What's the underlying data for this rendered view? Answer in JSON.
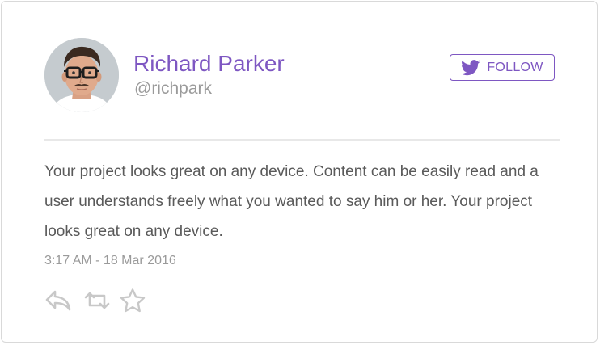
{
  "profile": {
    "name": "Richard Parker",
    "handle": "@richpark"
  },
  "follow_button": {
    "label": "FOLLOW",
    "icon": "twitter-bird-icon"
  },
  "tweet": {
    "text": "Your project looks great on any device. Content can be easily read and a user understands freely what you wanted to say him or her. Your project looks great on any device.",
    "timestamp": "3:17 AM - 18 Mar 2016"
  },
  "actions": [
    {
      "icon": "reply-icon"
    },
    {
      "icon": "retweet-icon"
    },
    {
      "icon": "star-icon"
    }
  ],
  "colors": {
    "accent": "#7e57c2",
    "text": "#5a5a5a",
    "muted": "#9a9a9a",
    "icon": "#c8c8c8",
    "divider": "#e8e8e8"
  }
}
